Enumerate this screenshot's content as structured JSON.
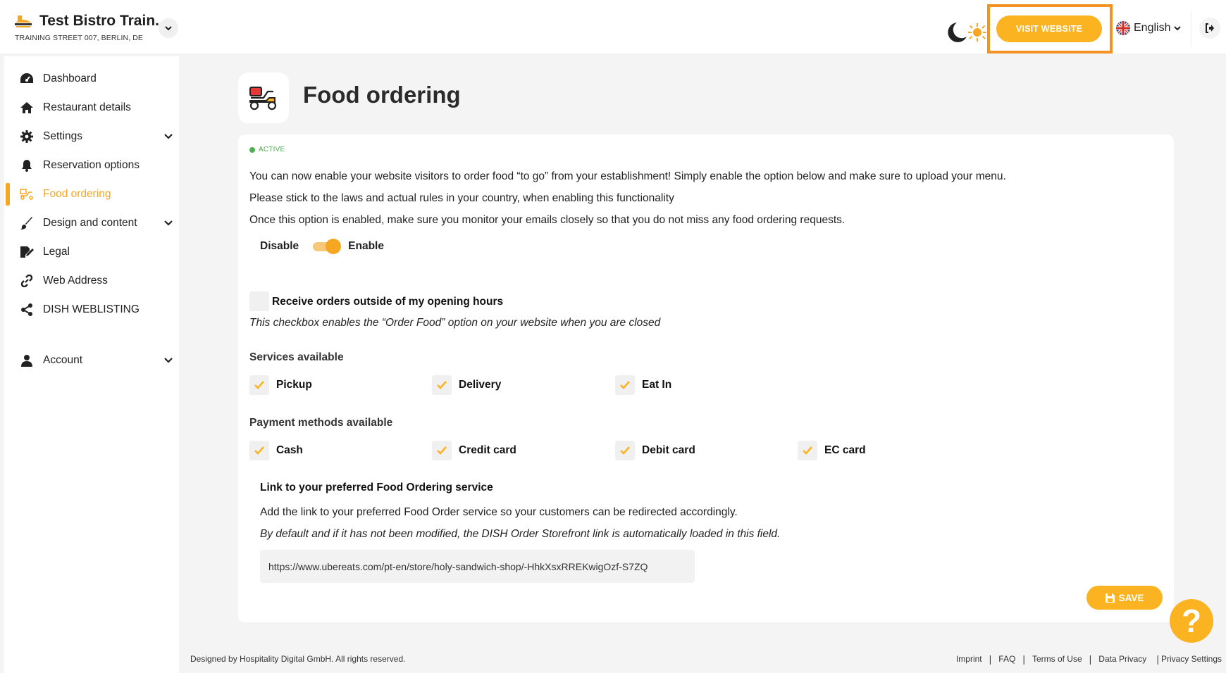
{
  "header": {
    "restaurant_name": "Test Bistro Train...",
    "address": "TRAINING STREET 007, BERLIN, DE",
    "visit_website_label": "VISIT WEBSITE",
    "language": "English"
  },
  "sidebar": {
    "items": [
      {
        "label": "Dashboard",
        "icon": "dashboard-icon"
      },
      {
        "label": "Restaurant details",
        "icon": "home-icon"
      },
      {
        "label": "Settings",
        "icon": "gear-icon"
      },
      {
        "label": "Reservation options",
        "icon": "bell-icon"
      },
      {
        "label": "Food ordering",
        "icon": "food-ordering-icon"
      },
      {
        "label": "Design and content",
        "icon": "brush-icon"
      },
      {
        "label": "Legal",
        "icon": "signature-icon"
      },
      {
        "label": "Web Address",
        "icon": "link-icon"
      },
      {
        "label": "DISH WEBLISTING",
        "icon": "share-icon"
      },
      {
        "label": "Account",
        "icon": "user-icon"
      }
    ]
  },
  "page": {
    "title": "Food ordering",
    "status": "ACTIVE",
    "intro_1": "You can now enable your website visitors to order food “to go” from your establishment! Simply enable the option below and make sure to upload your menu.",
    "intro_2": "Please stick to the laws and actual rules in your country, when enabling this functionality",
    "intro_3": "Once this option is enabled, make sure you monitor your emails closely so that you do not miss any food ordering requests.",
    "switch_off_label": "Disable",
    "switch_on_label": "Enable",
    "outside_hours_label": "Receive orders outside of my opening hours",
    "outside_hours_hint": "This checkbox enables the “Order Food” option on your website when you are closed",
    "services_label": "Services available",
    "services": [
      "Pickup",
      "Delivery",
      "Eat In"
    ],
    "payments_label": "Payment methods available",
    "payments": [
      "Cash",
      "Credit card",
      "Debit card",
      "EC card"
    ],
    "link_title": "Link to your preferred Food Ordering service",
    "link_desc": "Add the link to your preferred Food Order service so your customers can be redirected accordingly.",
    "link_note": "By default and if it has not been modified, the DISH Order Storefront link is automatically loaded in this field.",
    "link_value": "https://www.ubereats.com/pt-en/store/holy-sandwich-shop/-HhkXsxRREKwigOzf-S7ZQ",
    "save_label": "SAVE"
  },
  "help": {
    "label": "?"
  },
  "footer": {
    "copyright": "Designed by Hospitality Digital GmbH. All rights reserved.",
    "links": [
      "Imprint",
      "FAQ",
      "Terms of Use",
      "Data Privacy",
      "Privacy Settings"
    ]
  },
  "colors": {
    "accent": "#fbb321",
    "highlight": "#f59322",
    "active": "#4caf50"
  }
}
